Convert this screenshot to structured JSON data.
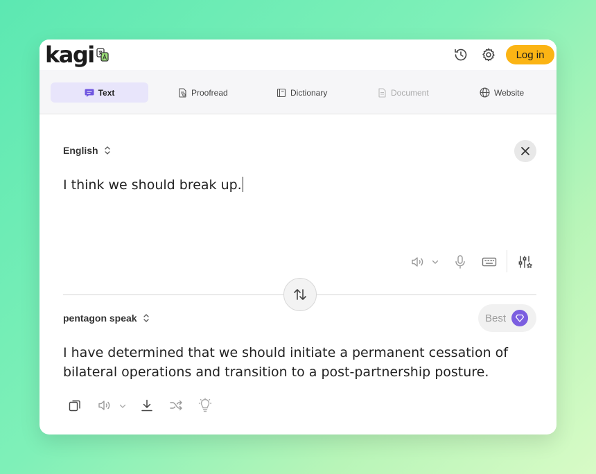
{
  "app": {
    "logo_text": "kagi"
  },
  "header": {
    "login_label": "Log in"
  },
  "tabs": [
    {
      "label": "Text",
      "icon": "chat-bubble-icon",
      "state": "active"
    },
    {
      "label": "Proofread",
      "icon": "proofread-doc-icon",
      "state": "normal"
    },
    {
      "label": "Dictionary",
      "icon": "book-icon",
      "state": "normal"
    },
    {
      "label": "Document",
      "icon": "document-icon",
      "state": "disabled"
    },
    {
      "label": "Website",
      "icon": "globe-icon",
      "state": "normal"
    }
  ],
  "source": {
    "language": "English",
    "text": "I think we should break up."
  },
  "target": {
    "language": "pentagon speak",
    "quality_label": "Best",
    "text": "I have determined that we should initiate a permanent cessation of bilateral operations and transition to a post-partnership posture."
  },
  "colors": {
    "accent": "#fbb414",
    "tab_active_bg": "#e8e5fb",
    "gem": "#7b5ee0"
  }
}
